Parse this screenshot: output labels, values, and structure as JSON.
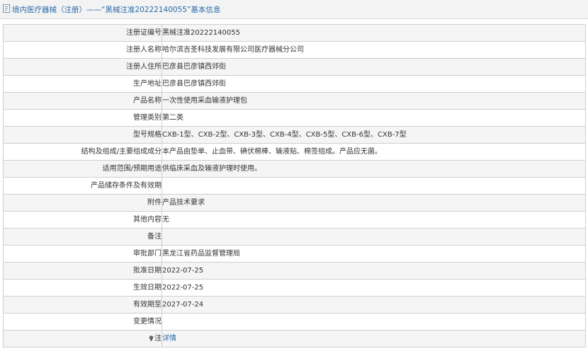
{
  "header": {
    "icon": "document-icon",
    "title": "境内医疗器械（注册）——“黑械注准20222140055”基本信息"
  },
  "rows": [
    {
      "label": "注册证编号",
      "value": "黑械注准20222140055"
    },
    {
      "label": "注册人名称",
      "value": "哈尔滨吉圣科技发展有限公司医疗器械分公司"
    },
    {
      "label": "注册人住所",
      "value": "巴彦县巴彦镇西郊街"
    },
    {
      "label": "生产地址",
      "value": "巴彦县巴彦镇西郊街"
    },
    {
      "label": "产品名称",
      "value": "一次性使用采血输液护理包"
    },
    {
      "label": "管理类别",
      "value": "第二类"
    },
    {
      "label": "型号规格",
      "value": "CXB-1型、CXB-2型、CXB-3型、CXB-4型、CXB-5型、CXB-6型、CXB-7型"
    },
    {
      "label": "结构及组成/主要组成成分",
      "value": "本产品由垫单、止血带、碘伏棉棒、输液贴、棉签组成。产品应无菌。"
    },
    {
      "label": "适用范围/预期用途",
      "value": "供临床采血及输液护理时使用。"
    },
    {
      "label": "产品储存条件及有效期",
      "value": ""
    },
    {
      "label": "附件",
      "value": "产品技术要求"
    },
    {
      "label": "其他内容",
      "value": "无"
    },
    {
      "label": "备注",
      "value": ""
    },
    {
      "label": "审批部门",
      "value": "黑龙江省药品监督管理局"
    },
    {
      "label": "批准日期",
      "value": "2022-07-25"
    },
    {
      "label": "生效日期",
      "value": "2022-07-25"
    },
    {
      "label": "有效期至",
      "value": "2027-07-24"
    },
    {
      "label": "变更情况",
      "value": ""
    }
  ],
  "note_row": {
    "icon": "lightbulb-icon",
    "label": "注",
    "link_text": "详情"
  },
  "colors": {
    "title": "#2a6aa9",
    "header_bg": "#f3f3f3",
    "row_alt_bg": "#f5f5f5",
    "border": "#cfcfcf"
  }
}
